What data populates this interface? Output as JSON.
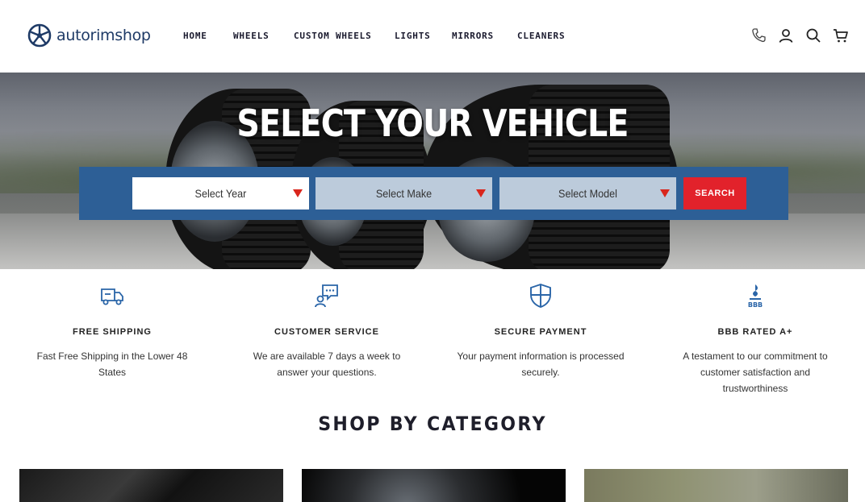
{
  "header": {
    "logo_text": "autorimshop",
    "nav": [
      "HOME",
      "WHEELS",
      "CUSTOM WHEELS",
      "LIGHTS",
      "MIRRORS",
      "CLEANERS"
    ],
    "icons": [
      "phone-icon",
      "account-icon",
      "search-icon",
      "cart-icon"
    ]
  },
  "hero": {
    "title": "SELECT YOUR VEHICLE",
    "year_placeholder": "Select Year",
    "make_placeholder": "Select Make",
    "model_placeholder": "Select Model",
    "search_label": "SEARCH"
  },
  "features": [
    {
      "icon": "truck-icon",
      "title": "FREE SHIPPING",
      "desc": "Fast Free Shipping in the Lower 48 States"
    },
    {
      "icon": "chat-support-icon",
      "title": "CUSTOMER SERVICE",
      "desc": "We are available 7 days a week to answer your questions."
    },
    {
      "icon": "shield-icon",
      "title": "SECURE PAYMENT",
      "desc": "Your payment information is processed securely."
    },
    {
      "icon": "bbb-icon",
      "title": "BBB RATED A+",
      "desc": "A testament to our commitment to customer satisfaction and trustworthiness"
    }
  ],
  "shop_by_category": {
    "title": "SHOP BY CATEGORY"
  },
  "colors": {
    "brand_blue": "#2d5f96",
    "search_red": "#e2222b",
    "caret_red": "#d9261c",
    "icon_blue": "#2a65a8"
  }
}
